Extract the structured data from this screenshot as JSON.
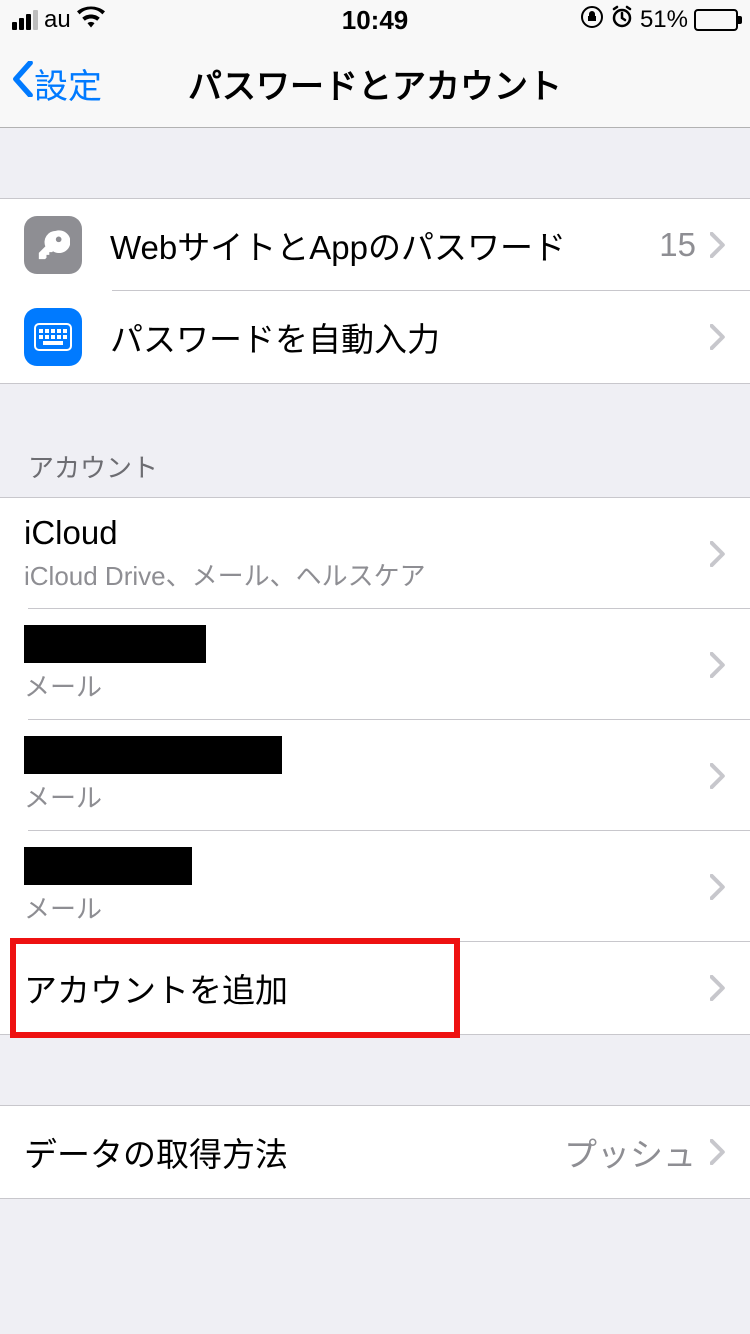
{
  "status": {
    "carrier": "au",
    "time": "10:49",
    "battery_pct": "51%"
  },
  "nav": {
    "back_label": "設定",
    "title": "パスワードとアカウント"
  },
  "passwords_group": {
    "websites_apps_label": "WebサイトとAppのパスワード",
    "websites_apps_count": "15",
    "autofill_label": "パスワードを自動入力"
  },
  "accounts_header": "アカウント",
  "accounts": [
    {
      "title": "iCloud",
      "sub": "iCloud Drive、メール、ヘルスケア",
      "redacted": false,
      "redact_w": 0
    },
    {
      "title": "",
      "sub": "メール",
      "redacted": true,
      "redact_w": 182
    },
    {
      "title": "",
      "sub": "メール",
      "redacted": true,
      "redact_w": 258
    },
    {
      "title": "",
      "sub": "メール",
      "redacted": true,
      "redact_w": 168
    }
  ],
  "add_account_label": "アカウントを追加",
  "fetch": {
    "label": "データの取得方法",
    "value": "プッシュ"
  }
}
